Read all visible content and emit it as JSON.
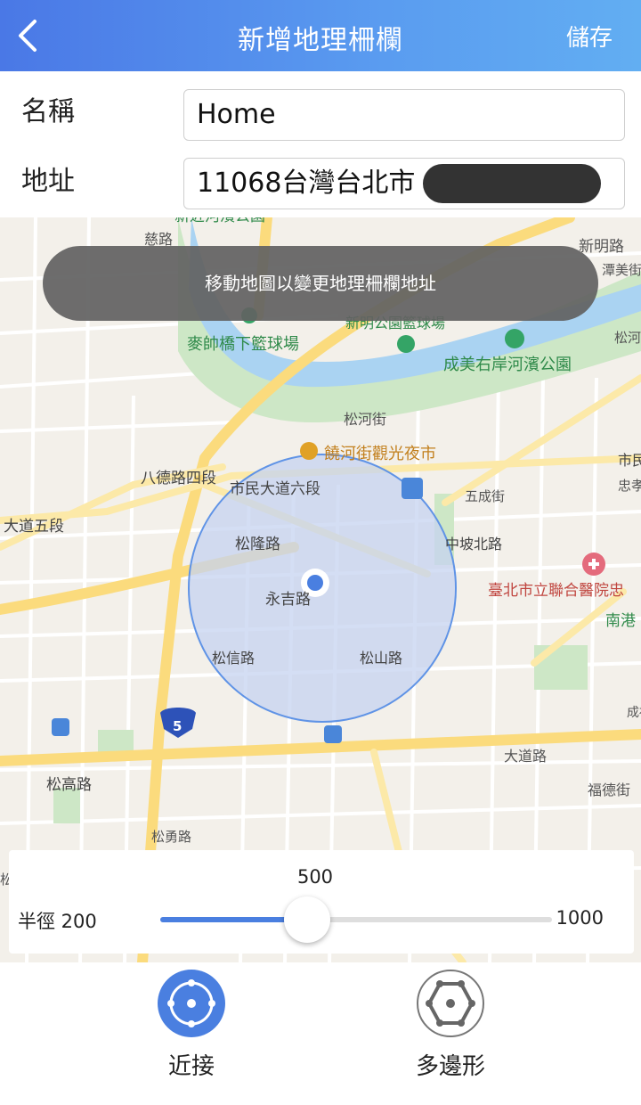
{
  "header": {
    "title": "新增地理柵欄",
    "save_label": "儲存"
  },
  "form": {
    "name_label": "名稱",
    "name_value": "Home",
    "address_label": "地址",
    "address_value": "11068台灣台北市"
  },
  "map": {
    "toast": "移動地圖以變更地理柵欄地址",
    "labels": {
      "park_top": "新近河濱公園",
      "street_top_left": "慈路",
      "road_xinming": "新明路",
      "road_tanmei": "潭美街",
      "court_maishuai": "麥帥橋下籃球場",
      "court_xinming": "新明公園籃球場",
      "park_chengmei": "成美右岸河濱公園",
      "road_songhe": "松河街",
      "road_song_right": "松河",
      "night_market": "饒河街觀光夜市",
      "road_bade": "八德路四段",
      "road_shimin": "市民大道六段",
      "road_shi": "市民",
      "road_zhong": "忠孝",
      "road_shimin5": "大道五段",
      "road_songlong": "松隆路",
      "road_wucheng": "五成街",
      "road_zhongpo": "中坡北路",
      "hospital": "臺北市立聯合醫院忠",
      "nangang": "南港",
      "road_yongji": "永吉路",
      "road_songxin": "松信路",
      "road_songshan": "松山路",
      "road_dadao": "大道路",
      "road_fude": "福德街",
      "road_chengfu": "成福",
      "road_songgao": "松高路",
      "road_songyong": "松勇路",
      "road_song_left": "松",
      "highway_shield": "5"
    }
  },
  "radius": {
    "value": "500",
    "label": "半徑 200",
    "min": 200,
    "max_label": "1000",
    "max": 1000,
    "current": 500
  },
  "modes": {
    "proximity_label": "近接",
    "polygon_label": "多邊形"
  },
  "colors": {
    "header_start": "#4a78e6",
    "header_end": "#62aef2",
    "accent": "#4a7fe0",
    "geofence_fill": "#c6d3f0",
    "geofence_stroke": "#5f93e6"
  }
}
